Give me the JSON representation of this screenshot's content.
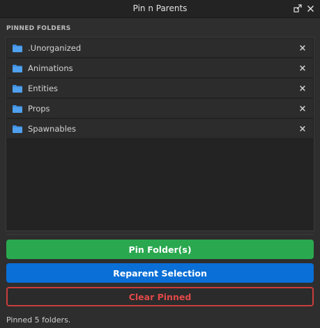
{
  "window": {
    "title": "Pin n Parents"
  },
  "icons": {
    "dock": "dock-icon",
    "close": "close-icon",
    "folder": "folder-icon",
    "remove": "remove-icon"
  },
  "colors": {
    "folder": "#3f8fe0",
    "pin_button": "#2aa84f",
    "reparent_button": "#0a6fd6",
    "clear_button_border": "#c93d3d",
    "clear_button_text": "#e04848"
  },
  "pinned": {
    "label": "PINNED FOLDERS",
    "items": [
      {
        "label": ".Unorganized",
        "remove": "×"
      },
      {
        "label": "Animations",
        "remove": "×"
      },
      {
        "label": "Entities",
        "remove": "×"
      },
      {
        "label": "Props",
        "remove": "×"
      },
      {
        "label": "Spawnables",
        "remove": "×"
      }
    ]
  },
  "buttons": {
    "pin": "Pin Folder(s)",
    "reparent": "Reparent Selection",
    "clear": "Clear Pinned"
  },
  "status": "Pinned 5 folders."
}
